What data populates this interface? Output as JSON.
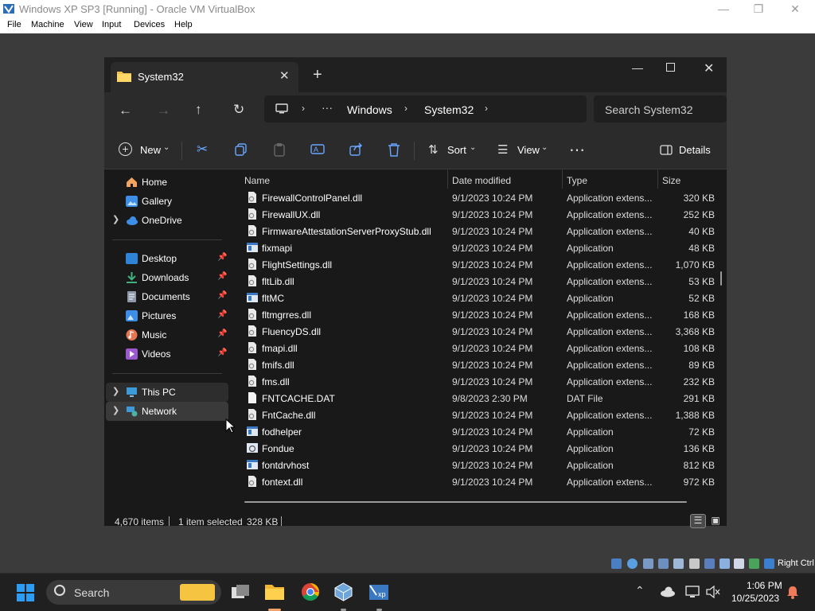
{
  "vbox": {
    "title": "Windows XP SP3 [Running] - Oracle VM VirtualBox",
    "menu": [
      "File",
      "Machine",
      "View",
      "Input",
      "Devices",
      "Help"
    ],
    "host_key": "Right Ctrl"
  },
  "explorer": {
    "tab_title": "System32",
    "breadcrumb": [
      "Windows",
      "System32"
    ],
    "search_placeholder": "Search System32",
    "toolbar": {
      "new": "New",
      "sort": "Sort",
      "view": "View",
      "details": "Details"
    },
    "nav": {
      "home": "Home",
      "gallery": "Gallery",
      "onedrive": "OneDrive",
      "desktop": "Desktop",
      "downloads": "Downloads",
      "documents": "Documents",
      "pictures": "Pictures",
      "music": "Music",
      "videos": "Videos",
      "thispc": "This PC",
      "network": "Network"
    },
    "columns": {
      "name": "Name",
      "date": "Date modified",
      "type": "Type",
      "size": "Size"
    },
    "files": [
      {
        "name": "FirewallControlPanel.dll",
        "date": "9/1/2023 10:24 PM",
        "type": "Application extens...",
        "size": "320 KB",
        "icon": "dll"
      },
      {
        "name": "FirewallUX.dll",
        "date": "9/1/2023 10:24 PM",
        "type": "Application extens...",
        "size": "252 KB",
        "icon": "dll"
      },
      {
        "name": "FirmwareAttestationServerProxyStub.dll",
        "date": "9/1/2023 10:24 PM",
        "type": "Application extens...",
        "size": "40 KB",
        "icon": "dll"
      },
      {
        "name": "fixmapi",
        "date": "9/1/2023 10:24 PM",
        "type": "Application",
        "size": "48 KB",
        "icon": "exe"
      },
      {
        "name": "FlightSettings.dll",
        "date": "9/1/2023 10:24 PM",
        "type": "Application extens...",
        "size": "1,070 KB",
        "icon": "dll"
      },
      {
        "name": "fltLib.dll",
        "date": "9/1/2023 10:24 PM",
        "type": "Application extens...",
        "size": "53 KB",
        "icon": "dll"
      },
      {
        "name": "fltMC",
        "date": "9/1/2023 10:24 PM",
        "type": "Application",
        "size": "52 KB",
        "icon": "exe"
      },
      {
        "name": "fltmgrres.dll",
        "date": "9/1/2023 10:24 PM",
        "type": "Application extens...",
        "size": "168 KB",
        "icon": "dll"
      },
      {
        "name": "FluencyDS.dll",
        "date": "9/1/2023 10:24 PM",
        "type": "Application extens...",
        "size": "3,368 KB",
        "icon": "dll"
      },
      {
        "name": "fmapi.dll",
        "date": "9/1/2023 10:24 PM",
        "type": "Application extens...",
        "size": "108 KB",
        "icon": "dll"
      },
      {
        "name": "fmifs.dll",
        "date": "9/1/2023 10:24 PM",
        "type": "Application extens...",
        "size": "89 KB",
        "icon": "dll"
      },
      {
        "name": "fms.dll",
        "date": "9/1/2023 10:24 PM",
        "type": "Application extens...",
        "size": "232 KB",
        "icon": "dll"
      },
      {
        "name": "FNTCACHE.DAT",
        "date": "9/8/2023 2:30 PM",
        "type": "DAT File",
        "size": "291 KB",
        "icon": "file"
      },
      {
        "name": "FntCache.dll",
        "date": "9/1/2023 10:24 PM",
        "type": "Application extens...",
        "size": "1,388 KB",
        "icon": "dll"
      },
      {
        "name": "fodhelper",
        "date": "9/1/2023 10:24 PM",
        "type": "Application",
        "size": "72 KB",
        "icon": "exe"
      },
      {
        "name": "Fondue",
        "date": "9/1/2023 10:24 PM",
        "type": "Application",
        "size": "136 KB",
        "icon": "fondue"
      },
      {
        "name": "fontdrvhost",
        "date": "9/1/2023 10:24 PM",
        "type": "Application",
        "size": "812 KB",
        "icon": "exe"
      },
      {
        "name": "fontext.dll",
        "date": "9/1/2023 10:24 PM",
        "type": "Application extens...",
        "size": "972 KB",
        "icon": "dll"
      }
    ],
    "status": {
      "items": "4,670 items",
      "selected": "1 item selected",
      "sel_size": "328 KB"
    }
  },
  "taskbar": {
    "search_label": "Search",
    "time": "1:06 PM",
    "date": "10/25/2023"
  }
}
